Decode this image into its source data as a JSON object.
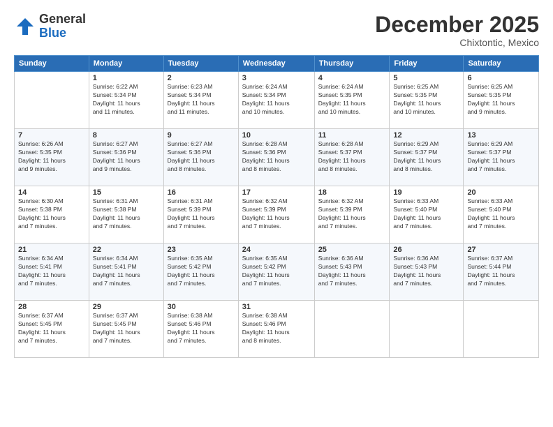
{
  "logo": {
    "general": "General",
    "blue": "Blue"
  },
  "header": {
    "month": "December 2025",
    "location": "Chixtontic, Mexico"
  },
  "weekdays": [
    "Sunday",
    "Monday",
    "Tuesday",
    "Wednesday",
    "Thursday",
    "Friday",
    "Saturday"
  ],
  "weeks": [
    [
      {
        "day": "",
        "info": ""
      },
      {
        "day": "1",
        "info": "Sunrise: 6:22 AM\nSunset: 5:34 PM\nDaylight: 11 hours\nand 11 minutes."
      },
      {
        "day": "2",
        "info": "Sunrise: 6:23 AM\nSunset: 5:34 PM\nDaylight: 11 hours\nand 11 minutes."
      },
      {
        "day": "3",
        "info": "Sunrise: 6:24 AM\nSunset: 5:34 PM\nDaylight: 11 hours\nand 10 minutes."
      },
      {
        "day": "4",
        "info": "Sunrise: 6:24 AM\nSunset: 5:35 PM\nDaylight: 11 hours\nand 10 minutes."
      },
      {
        "day": "5",
        "info": "Sunrise: 6:25 AM\nSunset: 5:35 PM\nDaylight: 11 hours\nand 10 minutes."
      },
      {
        "day": "6",
        "info": "Sunrise: 6:25 AM\nSunset: 5:35 PM\nDaylight: 11 hours\nand 9 minutes."
      }
    ],
    [
      {
        "day": "7",
        "info": "Sunrise: 6:26 AM\nSunset: 5:35 PM\nDaylight: 11 hours\nand 9 minutes."
      },
      {
        "day": "8",
        "info": "Sunrise: 6:27 AM\nSunset: 5:36 PM\nDaylight: 11 hours\nand 9 minutes."
      },
      {
        "day": "9",
        "info": "Sunrise: 6:27 AM\nSunset: 5:36 PM\nDaylight: 11 hours\nand 8 minutes."
      },
      {
        "day": "10",
        "info": "Sunrise: 6:28 AM\nSunset: 5:36 PM\nDaylight: 11 hours\nand 8 minutes."
      },
      {
        "day": "11",
        "info": "Sunrise: 6:28 AM\nSunset: 5:37 PM\nDaylight: 11 hours\nand 8 minutes."
      },
      {
        "day": "12",
        "info": "Sunrise: 6:29 AM\nSunset: 5:37 PM\nDaylight: 11 hours\nand 8 minutes."
      },
      {
        "day": "13",
        "info": "Sunrise: 6:29 AM\nSunset: 5:37 PM\nDaylight: 11 hours\nand 7 minutes."
      }
    ],
    [
      {
        "day": "14",
        "info": "Sunrise: 6:30 AM\nSunset: 5:38 PM\nDaylight: 11 hours\nand 7 minutes."
      },
      {
        "day": "15",
        "info": "Sunrise: 6:31 AM\nSunset: 5:38 PM\nDaylight: 11 hours\nand 7 minutes."
      },
      {
        "day": "16",
        "info": "Sunrise: 6:31 AM\nSunset: 5:39 PM\nDaylight: 11 hours\nand 7 minutes."
      },
      {
        "day": "17",
        "info": "Sunrise: 6:32 AM\nSunset: 5:39 PM\nDaylight: 11 hours\nand 7 minutes."
      },
      {
        "day": "18",
        "info": "Sunrise: 6:32 AM\nSunset: 5:39 PM\nDaylight: 11 hours\nand 7 minutes."
      },
      {
        "day": "19",
        "info": "Sunrise: 6:33 AM\nSunset: 5:40 PM\nDaylight: 11 hours\nand 7 minutes."
      },
      {
        "day": "20",
        "info": "Sunrise: 6:33 AM\nSunset: 5:40 PM\nDaylight: 11 hours\nand 7 minutes."
      }
    ],
    [
      {
        "day": "21",
        "info": "Sunrise: 6:34 AM\nSunset: 5:41 PM\nDaylight: 11 hours\nand 7 minutes."
      },
      {
        "day": "22",
        "info": "Sunrise: 6:34 AM\nSunset: 5:41 PM\nDaylight: 11 hours\nand 7 minutes."
      },
      {
        "day": "23",
        "info": "Sunrise: 6:35 AM\nSunset: 5:42 PM\nDaylight: 11 hours\nand 7 minutes."
      },
      {
        "day": "24",
        "info": "Sunrise: 6:35 AM\nSunset: 5:42 PM\nDaylight: 11 hours\nand 7 minutes."
      },
      {
        "day": "25",
        "info": "Sunrise: 6:36 AM\nSunset: 5:43 PM\nDaylight: 11 hours\nand 7 minutes."
      },
      {
        "day": "26",
        "info": "Sunrise: 6:36 AM\nSunset: 5:43 PM\nDaylight: 11 hours\nand 7 minutes."
      },
      {
        "day": "27",
        "info": "Sunrise: 6:37 AM\nSunset: 5:44 PM\nDaylight: 11 hours\nand 7 minutes."
      }
    ],
    [
      {
        "day": "28",
        "info": "Sunrise: 6:37 AM\nSunset: 5:45 PM\nDaylight: 11 hours\nand 7 minutes."
      },
      {
        "day": "29",
        "info": "Sunrise: 6:37 AM\nSunset: 5:45 PM\nDaylight: 11 hours\nand 7 minutes."
      },
      {
        "day": "30",
        "info": "Sunrise: 6:38 AM\nSunset: 5:46 PM\nDaylight: 11 hours\nand 7 minutes."
      },
      {
        "day": "31",
        "info": "Sunrise: 6:38 AM\nSunset: 5:46 PM\nDaylight: 11 hours\nand 8 minutes."
      },
      {
        "day": "",
        "info": ""
      },
      {
        "day": "",
        "info": ""
      },
      {
        "day": "",
        "info": ""
      }
    ]
  ]
}
